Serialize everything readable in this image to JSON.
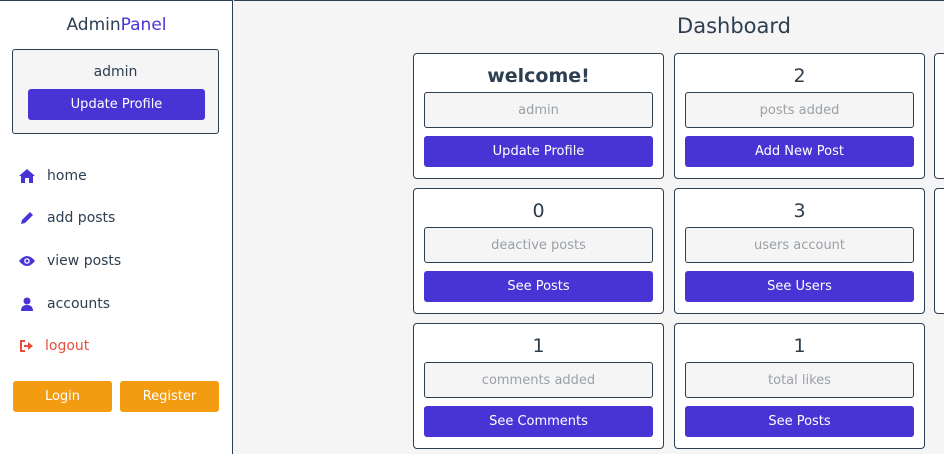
{
  "sidebar": {
    "brand_prefix": "Admin",
    "brand_accent": "Panel",
    "profile": {
      "name": "admin",
      "update_label": "Update Profile"
    },
    "nav": [
      {
        "label": "home",
        "icon": "home-icon"
      },
      {
        "label": "add posts",
        "icon": "pencil-icon"
      },
      {
        "label": "view posts",
        "icon": "eye-icon"
      },
      {
        "label": "accounts",
        "icon": "user-icon"
      },
      {
        "label": "logout",
        "icon": "sign-out-icon"
      }
    ],
    "login_label": "Login",
    "register_label": "Register"
  },
  "main": {
    "title": "Dashboard",
    "cards": [
      {
        "title": "welcome!",
        "field": "admin",
        "button": "Update Profile"
      },
      {
        "title": "2",
        "field": "posts added",
        "button": "Add New Post"
      },
      {
        "title": "0",
        "field": "deactive posts",
        "button": "See Posts"
      },
      {
        "title": "3",
        "field": "users account",
        "button": "See Users"
      },
      {
        "title": "1",
        "field": "comments added",
        "button": "See Comments"
      },
      {
        "title": "1",
        "field": "total likes",
        "button": "See Posts"
      }
    ]
  },
  "colors": {
    "primary": "#4834d4",
    "orange": "#f39c12",
    "danger": "#e74c3c",
    "text": "#2c3e50",
    "background": "#f5f5f5"
  }
}
